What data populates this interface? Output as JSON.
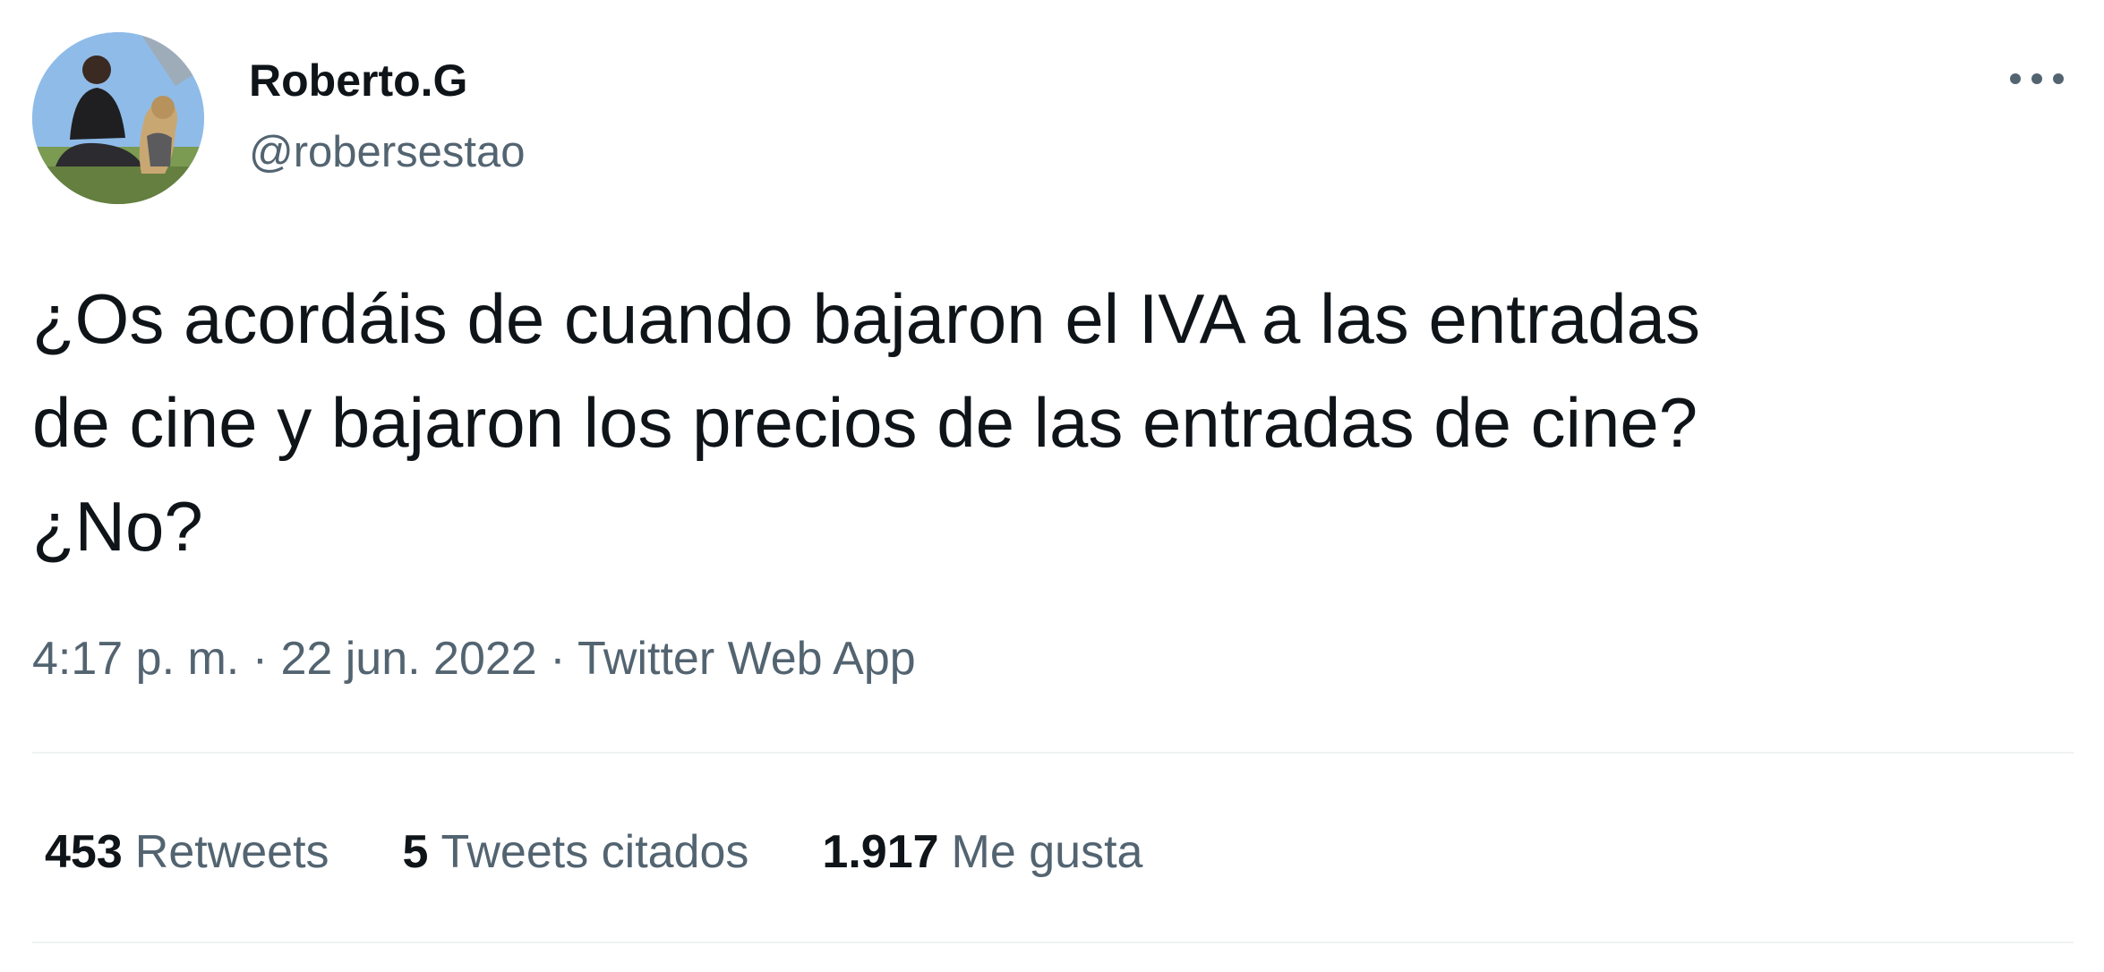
{
  "author": {
    "display_name": "Roberto.G",
    "handle": "@robersestao",
    "avatar_icon": "profile-photo-person-with-dog"
  },
  "tweet": {
    "text": "¿Os acordáis de cuando bajaron el IVA a las entradas\nde cine y bajaron los precios de las entradas de cine?\n¿No?",
    "time": "4:17 p. m.",
    "separator": "·",
    "date": "22 jun. 2022",
    "source": "Twitter Web App"
  },
  "stats": {
    "retweets_count": "453",
    "retweets_label": "Retweets",
    "quotes_count": "5",
    "quotes_label": "Tweets citados",
    "likes_count": "1.917",
    "likes_label": "Me gusta"
  },
  "icons": {
    "more": "more-horizontal-icon"
  },
  "colors": {
    "primary_text": "#0f1419",
    "secondary_text": "#536471",
    "divider": "#eff3f4"
  }
}
